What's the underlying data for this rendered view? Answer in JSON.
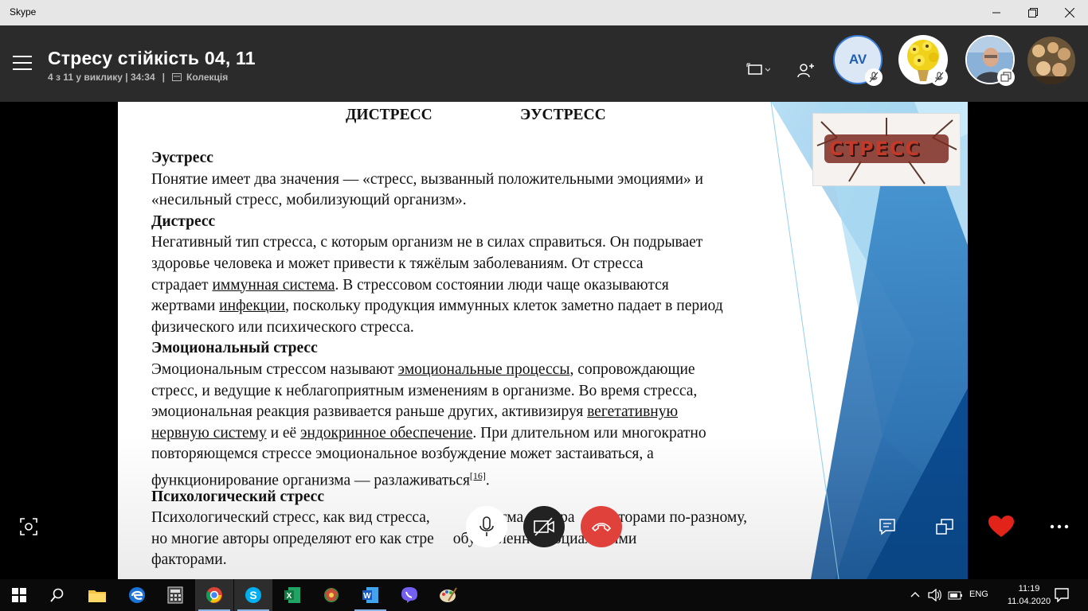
{
  "window": {
    "title": "Skype",
    "controls": [
      "minimize",
      "maximize",
      "close"
    ]
  },
  "call": {
    "title": "Стресу стійкість 04, 11",
    "participants_info": "4 з 11 у виклику | 34:34",
    "separator": "|",
    "collection_label": "Колекція",
    "participants": [
      {
        "initials": "AV",
        "muted": true
      },
      {
        "type": "photo-flowers",
        "muted": true
      },
      {
        "type": "photo-person",
        "screen_share": true
      },
      {
        "type": "photo-group"
      }
    ]
  },
  "slide": {
    "top_headings": [
      "ДИСТРЕСС",
      "ЭУСТРЕСС"
    ],
    "stress_image_text": "СТРЕСС",
    "sections": [
      {
        "heading": "Эустресс",
        "lines": [
          "Понятие имеет два значения — «стресс, вызванный положительными эмоциями» и",
          "«несильный стресс, мобилизующий организм»."
        ]
      },
      {
        "heading": "Дистресс",
        "lines": [
          "Негативный тип стресса, с которым организм не в силах справиться. Он подрывает",
          "здоровье человека и может привести к тяжёлым заболеваниям. От стресса"
        ],
        "line3_pre": "страдает ",
        "line3_link": "иммунная система",
        "line3_post": ". В стрессовом состоянии люди чаще оказываются",
        "line4_pre": "жертвами ",
        "line4_link": "инфекции",
        "line4_post": ", поскольку продукция иммунных клеток заметно падает в период",
        "line5": "физического или психического стресса."
      },
      {
        "heading": "Эмоциональный стресс",
        "l1_pre": "Эмоциональным стрессом называют ",
        "l1_link": "эмоциональные процессы",
        "l1_post": ", сопровождающие",
        "l2": "стресс, и ведущие к неблагоприятным изменениям в организме. Во время стресса,",
        "l3_pre": "эмоциональная реакция развивается раньше других, активизируя ",
        "l3_link": "вегетативную",
        "l4_link1": "нервную систему",
        "l4_mid": " и её ",
        "l4_link2": "эндокринное обеспечение",
        "l4_post": ". При длительном или многократно",
        "l5": "повторяющемся стрессе эмоциональное возбуждение может застаиваться, а",
        "l6_pre": "функционирование организма — разлаживаться",
        "l6_sup": "[16]",
        "l6_post": "."
      },
      {
        "heading": "Психологический стресс",
        "l1": "Психологический стресс, как вид стресса,",
        "l1_b": "тма",
        "l1_c": "ра",
        "l1_d": "и авторами по-разному,",
        "l2_pre": "но многие авторы определяют его как стре",
        "l2_b": "обус",
        "l2_c": "ленн",
        "l2_d": " социальными",
        "l3": "факторами."
      }
    ]
  },
  "controls": {
    "colors": {
      "end_call": "#e0413b",
      "mic_bg": "#ffffff",
      "video_bg": "#222222",
      "heart": "#e2231a"
    }
  },
  "taskbar": {
    "language": "ENG",
    "time": "11:19",
    "date": "11.04.2020",
    "apps": [
      "start",
      "search",
      "file-explorer",
      "edge",
      "calculator",
      "chrome",
      "skype",
      "excel",
      "game",
      "word",
      "viber",
      "paint"
    ]
  }
}
